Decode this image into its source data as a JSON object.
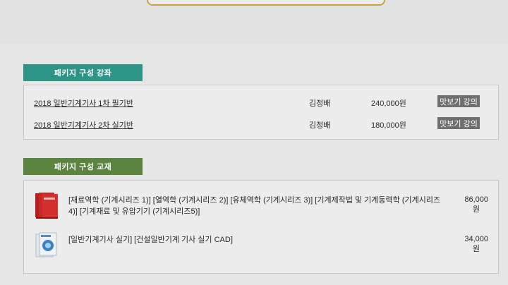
{
  "lectures_section": {
    "title": "패키지 구성 강좌",
    "rows": [
      {
        "title": "2018 일반기계기사 1차 필기반",
        "teacher": "김정배",
        "price": "240,000원",
        "preview": "맛보기 강의"
      },
      {
        "title": "2018 일반기계기사 2차 실기반",
        "teacher": "김정배",
        "price": "180,000원",
        "preview": "맛보기 강의"
      }
    ]
  },
  "textbooks_section": {
    "title": "패키지 구성 교재",
    "rows": [
      {
        "desc": "[재료역학 (기계시리즈 1)] [열역학 (기계시리즈 2)] [유체역학 (기계시리즈 3)] [기계제작법 및 기계동력학 (기계시리즈 4)] [기계재료 및 유압기기 (기계시리즈5)]",
        "price": "86,000",
        "unit": "원",
        "icon": "red-book-set-icon"
      },
      {
        "desc": "[일반기계기사 실기] [건설일반기계 기사 실기 CAD]",
        "price": "34,000",
        "unit": "원",
        "icon": "blue-book-set-icon"
      }
    ]
  },
  "colors": {
    "lectures_tab": "#2f9488",
    "textbooks_tab": "#5b8440",
    "preview_button": "#6f6f6f",
    "top_box_border": "#c9a24a"
  }
}
